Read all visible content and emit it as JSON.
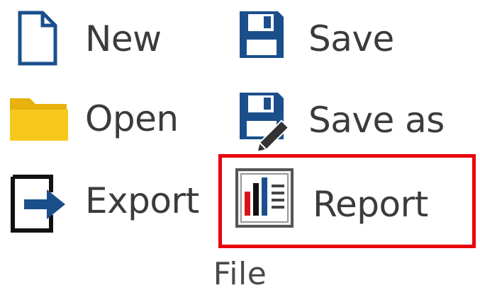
{
  "group": {
    "label": "File"
  },
  "buttons": {
    "new": {
      "label": "New",
      "icon": "new-document-icon"
    },
    "open": {
      "label": "Open",
      "icon": "folder-icon"
    },
    "export": {
      "label": "Export",
      "icon": "export-icon"
    },
    "save": {
      "label": "Save",
      "icon": "floppy-disk-icon"
    },
    "save_as": {
      "label": "Save as",
      "icon": "floppy-disk-pen-icon"
    },
    "report": {
      "label": "Report",
      "icon": "report-chart-icon",
      "highlight_color": "#e8000b"
    }
  },
  "colors": {
    "icon_blue": "#1a4f8c",
    "folder_yellow": "#f5c518",
    "bar_red": "#d7141a",
    "bar_blue": "#1a4f8c",
    "text": "#3b3b3b"
  }
}
